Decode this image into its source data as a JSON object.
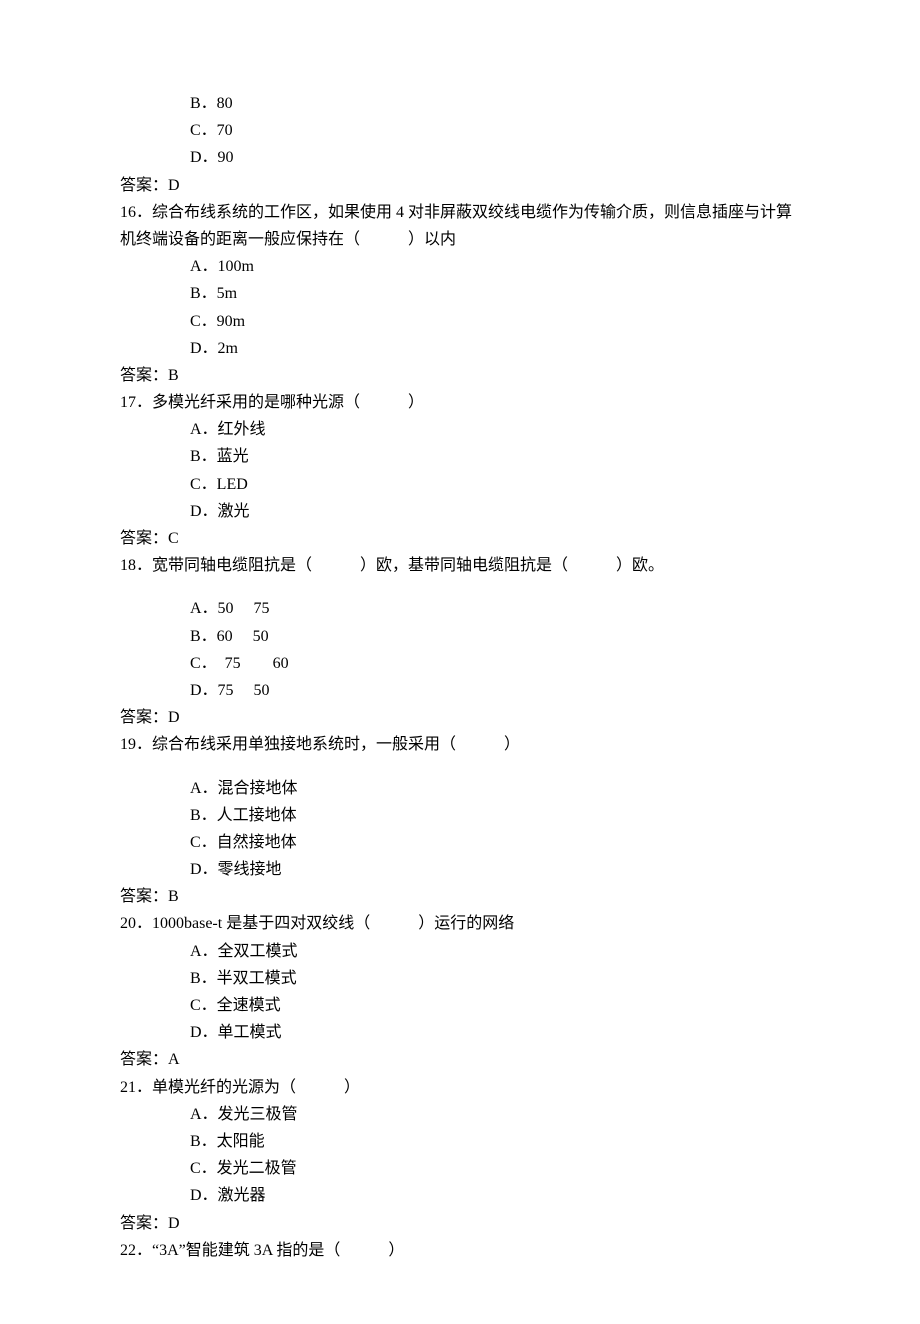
{
  "q15": {
    "optB": "B．80",
    "optC": "C．70",
    "optD": "D．90",
    "answer": "答案：D"
  },
  "q16": {
    "stem": "16．综合布线系统的工作区，如果使用 4 对非屏蔽双绞线电缆作为传输介质，则信息插座与计算机终端设备的距离一般应保持在（　　　）以内",
    "optA": "A．100m",
    "optB": "B．5m",
    "optC": "C．90m",
    "optD": "D．2m",
    "answer": "答案：B"
  },
  "q17": {
    "stem": "17．多模光纤采用的是哪种光源（　　　）",
    "optA": "A．红外线",
    "optB": "B．蓝光",
    "optC": "C．LED",
    "optD": "D．激光",
    "answer": "答案：C"
  },
  "q18": {
    "stem": "18．宽带同轴电缆阻抗是（　　　）欧，基带同轴电缆阻抗是（　　　）欧。",
    "optA": "A．50　 75",
    "optB": "B．60　 50",
    "optC": "C．　75　　60",
    "optD": "D．75　 50",
    "answer": "答案：D"
  },
  "q19": {
    "stem": "19．综合布线采用单独接地系统时，一般采用（　　　）",
    "optA": "A．混合接地体",
    "optB": "B．人工接地体",
    "optC": "C．自然接地体",
    "optD": "D．零线接地",
    "answer": "答案：B"
  },
  "q20": {
    "stem": "20．1000base-t 是基于四对双绞线（　　　）运行的网络",
    "optA": "A．全双工模式",
    "optB": "B．半双工模式",
    "optC": "C．全速模式",
    "optD": "D．单工模式",
    "answer": "答案：A"
  },
  "q21": {
    "stem": "21．单模光纤的光源为（　　　）",
    "optA": "A．发光三极管",
    "optB": "B．太阳能",
    "optC": "C．发光二极管",
    "optD": "D．激光器",
    "answer": "答案：D"
  },
  "q22": {
    "stem": "22．“3A”智能建筑 3A 指的是（　　　）"
  }
}
